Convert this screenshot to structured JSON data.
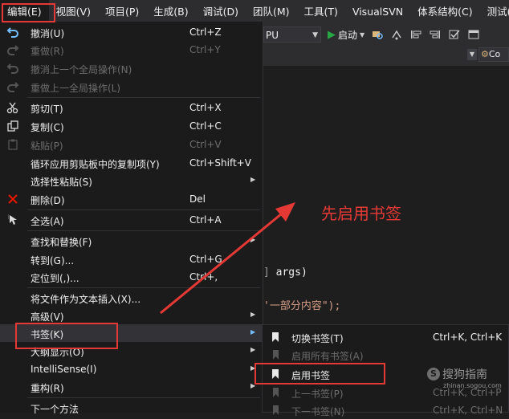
{
  "menubar": {
    "items": [
      "编辑(E)",
      "视图(V)",
      "项目(P)",
      "生成(B)",
      "调试(D)",
      "团队(M)",
      "工具(T)",
      "VisualSVN",
      "体系结构(C)",
      "测试(S)"
    ]
  },
  "toolbar": {
    "platform": "PU",
    "start_label": "启动"
  },
  "tabrow": {
    "nav_text": "Co"
  },
  "code": {
    "line1": "args)",
    "line2": "'一部分内容\");"
  },
  "edit_menu": {
    "items": [
      {
        "label": "撤消(U)",
        "shortcut": "Ctrl+Z"
      },
      {
        "label": "重做(R)",
        "shortcut": "Ctrl+Y"
      },
      {
        "label": "撤消上一个全局操作(N)",
        "shortcut": ""
      },
      {
        "label": "重做上一全局操作(L)",
        "shortcut": ""
      },
      {
        "label": "剪切(T)",
        "shortcut": "Ctrl+X"
      },
      {
        "label": "复制(C)",
        "shortcut": "Ctrl+C"
      },
      {
        "label": "粘贴(P)",
        "shortcut": "Ctrl+V"
      },
      {
        "label": "循环应用剪贴板中的复制项(Y)",
        "shortcut": "Ctrl+Shift+V"
      },
      {
        "label": "选择性粘贴(S)",
        "shortcut": ""
      },
      {
        "label": "删除(D)",
        "shortcut": "Del"
      },
      {
        "label": "全选(A)",
        "shortcut": "Ctrl+A"
      },
      {
        "label": "查找和替换(F)",
        "shortcut": ""
      },
      {
        "label": "转到(G)...",
        "shortcut": "Ctrl+G"
      },
      {
        "label": "定位到(,)...",
        "shortcut": "Ctrl+,"
      },
      {
        "label": "将文件作为文本插入(X)...",
        "shortcut": ""
      },
      {
        "label": "高级(V)",
        "shortcut": ""
      },
      {
        "label": "书签(K)",
        "shortcut": ""
      },
      {
        "label": "大纲显示(O)",
        "shortcut": ""
      },
      {
        "label": "IntelliSense(I)",
        "shortcut": ""
      },
      {
        "label": "重构(R)",
        "shortcut": ""
      },
      {
        "label": "下一个方法",
        "shortcut": ""
      }
    ]
  },
  "bookmark_submenu": {
    "items": [
      {
        "label": "切换书签(T)",
        "shortcut": "Ctrl+K, Ctrl+K"
      },
      {
        "label": "启用所有书签(A)",
        "shortcut": ""
      },
      {
        "label": "启用书签",
        "shortcut": ""
      },
      {
        "label": "上一书签(P)",
        "shortcut": "Ctrl+K, Ctrl+P"
      },
      {
        "label": "下一书签(N)",
        "shortcut": "Ctrl+K, Ctrl+N"
      }
    ]
  },
  "annotation": {
    "text": "先启用书签"
  },
  "watermark": {
    "main": "搜狗指南",
    "sub": "zhinan.sogou.com",
    "logo": "S"
  },
  "colors": {
    "annotation_red": "#e53935",
    "menu_bg": "#1b1b1c",
    "menubar_bg": "#2d2d30"
  }
}
